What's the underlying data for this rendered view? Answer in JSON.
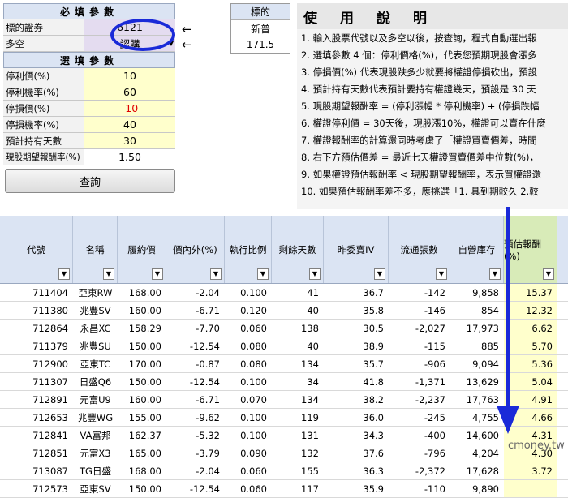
{
  "form": {
    "required_header": "必填參數",
    "stock_label": "標的證券",
    "stock_value": "6121",
    "direction_label": "多空",
    "direction_value": "認購",
    "optional_header": "選填參數",
    "params": [
      {
        "label": "停利價(%)",
        "value": "10",
        "red": false
      },
      {
        "label": "停利機率(%)",
        "value": "60",
        "red": false
      },
      {
        "label": "停損價(%)",
        "value": "-10",
        "red": true
      },
      {
        "label": "停損機率(%)",
        "value": "40",
        "red": false
      },
      {
        "label": "預計持有天數",
        "value": "30",
        "red": false
      }
    ],
    "expected_return_label": "現股期望報酬率(%)",
    "expected_return_value": "1.50",
    "query_button": "查詢"
  },
  "stock_box": {
    "header": "標的",
    "name": "新普",
    "price": "171.5"
  },
  "instructions": {
    "title": "使用說明",
    "lines": [
      "1. 輸入股票代號以及多空以後，按查詢，程式自動選出報",
      "2. 選填參數 4 個：停利價格(%)，代表您預期現股會漲多",
      "3. 停損價(%) 代表現股跌多少就要將權證停損砍出，預設",
      "4. 預計持有天數代表預計要持有權證幾天，預設是 30 天",
      "5. 現股期望報酬率 = (停利漲幅 * 停利機率) + (停損跌幅",
      "6. 權證停利價 = 30天後，現股漲10%，權證可以賣在什麼",
      "7. 權證報酬率的計算還同時考慮了「權證買賣價差，時間",
      "8. 右下方預估價差 = 最近七天權證買賣價差中位數(%)，",
      "9. 如果權證預估報酬率 < 現股期望報酬率，表示買權證還",
      "10. 如果預估報酬率差不多，應挑選「1. 具到期較久 2.較"
    ]
  },
  "table": {
    "headers": [
      "代號",
      "名稱",
      "履約價",
      "價內外(%)",
      "執行比例",
      "剩餘天數",
      "昨委賣IV",
      "流通張數",
      "自營庫存",
      "預估報酬(%)"
    ],
    "rows": [
      [
        "711404",
        "亞東RW",
        "168.00",
        "-2.04",
        "0.100",
        "41",
        "36.7",
        "-142",
        "9,858",
        "15.37"
      ],
      [
        "711380",
        "兆豐SV",
        "160.00",
        "-6.71",
        "0.120",
        "40",
        "35.8",
        "-146",
        "854",
        "12.32"
      ],
      [
        "712864",
        "永昌XC",
        "158.29",
        "-7.70",
        "0.060",
        "138",
        "30.5",
        "-2,027",
        "17,973",
        "6.62"
      ],
      [
        "711379",
        "兆豐SU",
        "150.00",
        "-12.54",
        "0.080",
        "40",
        "38.9",
        "-115",
        "885",
        "5.70"
      ],
      [
        "712900",
        "亞東TC",
        "170.00",
        "-0.87",
        "0.080",
        "134",
        "35.7",
        "-906",
        "9,094",
        "5.36"
      ],
      [
        "711307",
        "日盛Q6",
        "150.00",
        "-12.54",
        "0.100",
        "34",
        "41.8",
        "-1,371",
        "13,629",
        "5.04"
      ],
      [
        "712891",
        "元富U9",
        "160.00",
        "-6.71",
        "0.070",
        "134",
        "38.2",
        "-2,237",
        "17,763",
        "4.91"
      ],
      [
        "712653",
        "兆豐WG",
        "155.00",
        "-9.62",
        "0.100",
        "119",
        "36.0",
        "-245",
        "4,755",
        "4.66"
      ],
      [
        "712841",
        "VA富邦",
        "162.37",
        "-5.32",
        "0.100",
        "131",
        "34.3",
        "-400",
        "14,600",
        "4.31"
      ],
      [
        "712851",
        "元富X3",
        "165.00",
        "-3.79",
        "0.090",
        "132",
        "37.6",
        "-796",
        "4,204",
        "4.30"
      ],
      [
        "713087",
        "TG日盛",
        "168.00",
        "-2.04",
        "0.060",
        "155",
        "36.3",
        "-2,372",
        "17,628",
        "3.72"
      ],
      [
        "712573",
        "亞東SV",
        "150.00",
        "-12.54",
        "0.060",
        "117",
        "35.9",
        "-110",
        "9,890",
        ""
      ]
    ]
  },
  "watermark": "cmoney.tw",
  "colors": {
    "circle": "#1a2ad8",
    "negative": "#e00000",
    "highlight": "#ffffcc",
    "header": "#dbe4f3"
  }
}
